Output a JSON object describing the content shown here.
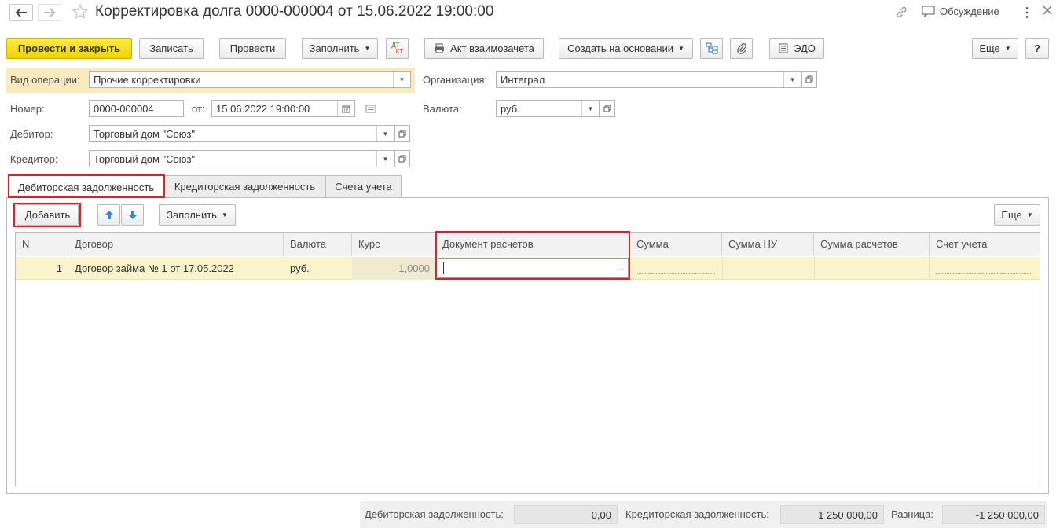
{
  "window": {
    "title": "Корректировка долга 0000-000004 от 15.06.2022 19:00:00",
    "discussion_label": "Обсуждение"
  },
  "toolbar": {
    "post_and_close": "Провести и закрыть",
    "save": "Записать",
    "post": "Провести",
    "fill": "Заполнить",
    "dt_kt_top": "ДТ",
    "dt_kt_bottom": "КТ",
    "netting_act": "Акт взаимозачета",
    "create_based_on": "Создать на основании",
    "edo": "ЭДО",
    "more": "Еще",
    "help": "?"
  },
  "form": {
    "operation_type_label": "Вид операции:",
    "operation_type_value": "Прочие корректировки",
    "organization_label": "Организация:",
    "organization_value": "Интеграл",
    "number_label": "Номер:",
    "number_value": "0000-000004",
    "date_label": "от:",
    "date_value": "15.06.2022 19:00:00",
    "currency_label": "Валюта:",
    "currency_value": "руб.",
    "debtor_label": "Дебитор:",
    "debtor_value": "Торговый дом \"Союз\"",
    "creditor_label": "Кредитор:",
    "creditor_value": "Торговый дом \"Союз\""
  },
  "tabs": [
    {
      "label": "Дебиторская задолженность",
      "active": true
    },
    {
      "label": "Кредиторская задолженность",
      "active": false
    },
    {
      "label": "Счета учета",
      "active": false
    }
  ],
  "table_toolbar": {
    "add": "Добавить",
    "fill": "Заполнить",
    "more": "Еще"
  },
  "table": {
    "columns": [
      "N",
      "Договор",
      "Валюта",
      "Курс",
      "Документ расчетов",
      "Сумма",
      "Сумма НУ",
      "Сумма расчетов",
      "Счет учета"
    ],
    "rows": [
      {
        "n": "1",
        "contract": "Договор займа № 1 от 17.05.2022",
        "currency": "руб.",
        "rate": "1,0000",
        "doc": "",
        "doc_btn": "...",
        "sum": "",
        "sum_nu": "",
        "sum_calc": "",
        "account": ""
      }
    ]
  },
  "footer": {
    "receivable_label": "Дебиторская задолженность:",
    "receivable_value": "0,00",
    "payable_label": "Кредиторская задолженность:",
    "payable_value": "1 250 000,00",
    "difference_label": "Разница:",
    "difference_value": "-1 250 000,00"
  },
  "colors": {
    "primary_button": "#f5dd1c",
    "highlight_row": "#fbf3cc",
    "operation_highlight": "#fbe9bf",
    "annotation_red": "#d8232a"
  }
}
